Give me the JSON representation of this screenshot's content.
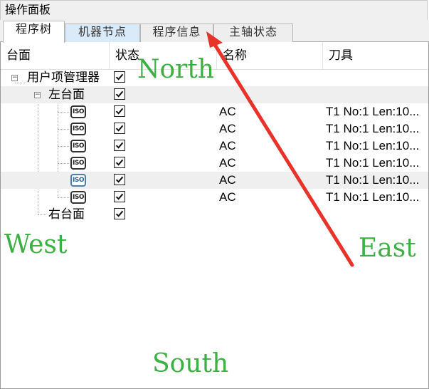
{
  "panel": {
    "title": "操作面板"
  },
  "tabs": [
    {
      "label": "程序树",
      "active": true
    },
    {
      "label": "机器节点",
      "active": false
    },
    {
      "label": "程序信息",
      "active": false
    },
    {
      "label": "主轴状态",
      "active": false
    }
  ],
  "columns": {
    "c0": "台面",
    "c1": "状态",
    "c2": "名称",
    "c3": "刀具"
  },
  "tree": {
    "root": {
      "label": "用户项管理器",
      "checked": true
    },
    "left": {
      "label": "左台面",
      "checked": true
    },
    "ops": [
      {
        "name": "AC",
        "tool": "T1 No:1 Len:10...",
        "checked": true,
        "selected": false
      },
      {
        "name": "AC",
        "tool": "T1 No:1 Len:10...",
        "checked": true,
        "selected": false
      },
      {
        "name": "AC",
        "tool": "T1 No:1 Len:10...",
        "checked": true,
        "selected": false
      },
      {
        "name": "AC",
        "tool": "T1 No:1 Len:10...",
        "checked": true,
        "selected": false
      },
      {
        "name": "AC",
        "tool": "T1 No:1 Len:10...",
        "checked": true,
        "selected": true
      },
      {
        "name": "AC",
        "tool": "T1 No:1 Len:10...",
        "checked": true,
        "selected": false
      }
    ],
    "right": {
      "label": "右台面",
      "checked": true
    },
    "iso_icon_label": "ISO"
  },
  "overlay": {
    "north": "North",
    "south": "South",
    "east": "East",
    "west": "West",
    "label_color": "#3cb043",
    "arrow_color": "#e8332a"
  }
}
